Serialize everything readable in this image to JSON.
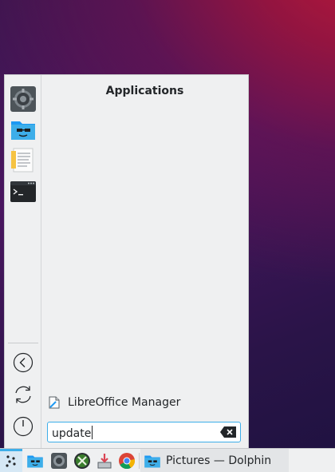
{
  "launcher": {
    "section_title": "Applications",
    "favorites": [
      {
        "name": "System Settings",
        "icon": "system-settings-icon"
      },
      {
        "name": "Dolphin",
        "icon": "dolphin-folder-icon"
      },
      {
        "name": "Text Editor",
        "icon": "text-editor-icon"
      },
      {
        "name": "Konsole",
        "icon": "terminal-icon"
      }
    ],
    "system_buttons": [
      "back-icon",
      "refresh-icon",
      "power-icon"
    ],
    "results": [
      {
        "label": "LibreOffice Manager",
        "icon": "libreoffice-icon"
      }
    ],
    "search": {
      "value": "update"
    }
  },
  "taskbar": {
    "launchers": [
      "kickoff-icon",
      "dolphin-folder-icon",
      "system-settings-icon",
      "crossover-icon",
      "installer-icon",
      "chrome-icon"
    ],
    "tasks": [
      {
        "label": "Pictures — Dolphin",
        "icon": "dolphin-folder-icon"
      }
    ]
  },
  "colors": {
    "accent": "#3daee9",
    "panel": "#eff0f1",
    "text": "#232629"
  }
}
